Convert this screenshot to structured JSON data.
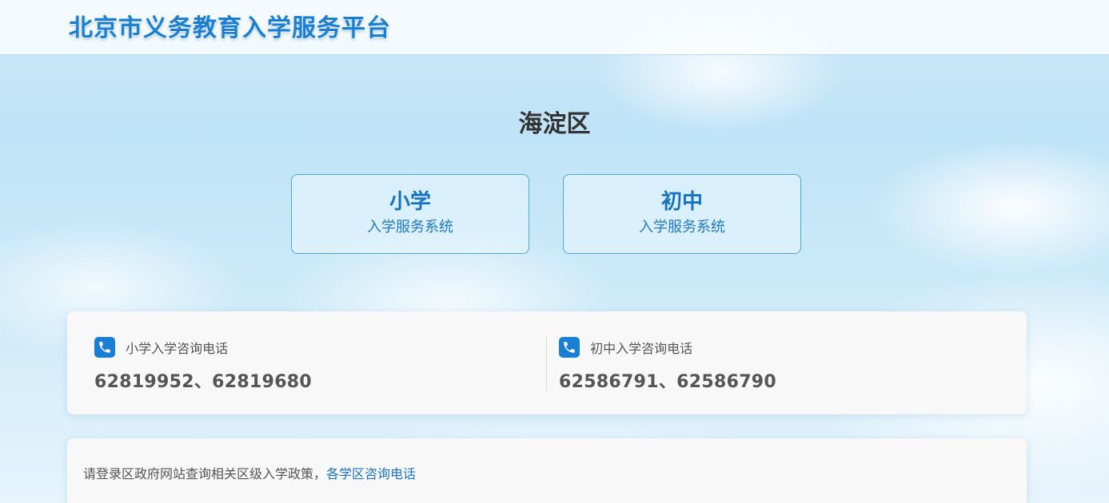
{
  "header": {
    "site_title": "北京市义务教育入学服务平台"
  },
  "district_title": "海淀区",
  "systems": [
    {
      "name": "小学",
      "subtitle": "入学服务系统"
    },
    {
      "name": "初中",
      "subtitle": "入学服务系统"
    }
  ],
  "contacts": [
    {
      "icon": "phone-icon",
      "label": "小学入学咨询电话",
      "numbers": "62819952、62819680"
    },
    {
      "icon": "phone-icon",
      "label": "初中入学咨询电话",
      "numbers": "62586791、62586790"
    }
  ],
  "policy": {
    "text": "请登录区政府网站查询相关区级入学政策，",
    "link_label": "各学区咨询电话"
  },
  "colors": {
    "accent": "#1a7fd4",
    "card_border": "#4ea8e4",
    "link": "#1a73c9"
  }
}
